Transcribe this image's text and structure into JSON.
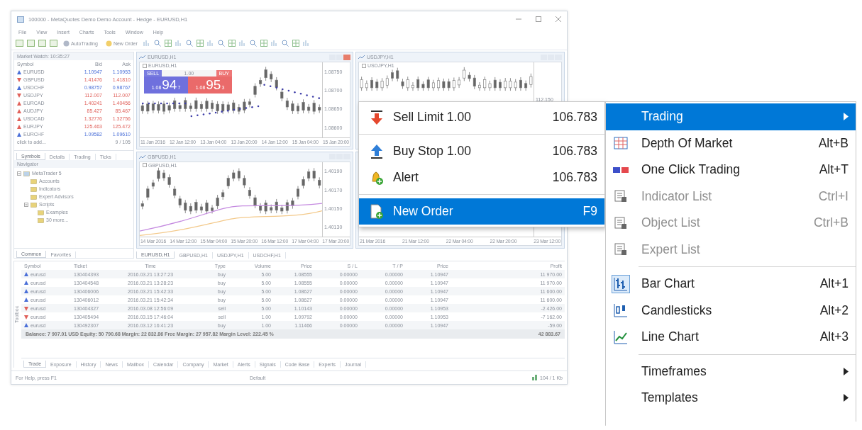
{
  "window": {
    "title": "100000 - MetaQuotes Demo Demo Account - Hedge - EURUSD,H1"
  },
  "menu": [
    "File",
    "View",
    "Insert",
    "Charts",
    "Tools",
    "Window",
    "Help"
  ],
  "toolbar": {
    "buttons": [
      "AutoTrading",
      "New Order"
    ]
  },
  "market_watch": {
    "title": "Market Watch: 10:35:27",
    "columns": [
      "Symbol",
      "Bid",
      "Ask"
    ],
    "rows": [
      {
        "symbol": "EURUSD",
        "bid": "1.10947",
        "ask": "1.10953",
        "kind": "up",
        "color": "#4a6fd8"
      },
      {
        "symbol": "GBPUSD",
        "bid": "1.41476",
        "ask": "1.41810",
        "kind": "down",
        "color": "#e0605a"
      },
      {
        "symbol": "USDCHF",
        "bid": "0.98757",
        "ask": "0.98767",
        "kind": "up",
        "color": "#4a6fd8"
      },
      {
        "symbol": "USDJPY",
        "bid": "112.007",
        "ask": "112.007",
        "kind": "down",
        "color": "#e0605a"
      },
      {
        "symbol": "EURCAD",
        "bid": "1.40241",
        "ask": "1.40456",
        "kind": "up",
        "color": "#e0605a"
      },
      {
        "symbol": "AUDJPY",
        "bid": "85.427",
        "ask": "85.467",
        "kind": "up",
        "color": "#e0605a"
      },
      {
        "symbol": "USDCAD",
        "bid": "1.32776",
        "ask": "1.32756",
        "kind": "up",
        "color": "#e0605a"
      },
      {
        "symbol": "EURJPY",
        "bid": "125.463",
        "ask": "125.472",
        "kind": "up",
        "color": "#e0605a"
      },
      {
        "symbol": "EURCHF",
        "bid": "1.09582",
        "ask": "1.09610",
        "kind": "up",
        "color": "#4a6fd8"
      }
    ],
    "add_row": "click to add...",
    "add_count": "9 / 105",
    "tabs": [
      {
        "label": "Symbols",
        "selected": true
      },
      {
        "label": "Details",
        "selected": false
      },
      {
        "label": "Trading",
        "selected": false
      },
      {
        "label": "Ticks",
        "selected": false
      }
    ]
  },
  "navigator": {
    "title": "Navigator",
    "tree": [
      {
        "label": "MetaTrader 5",
        "children": [
          {
            "label": "Accounts"
          },
          {
            "label": "Indicators"
          },
          {
            "label": "Expert Advisors"
          },
          {
            "label": "Scripts",
            "children": [
              {
                "label": "Examples"
              },
              {
                "label": "30 more..."
              }
            ]
          }
        ]
      }
    ],
    "tabs": [
      {
        "label": "Common",
        "selected": true
      },
      {
        "label": "Favorites",
        "selected": false
      }
    ]
  },
  "charts": [
    {
      "title": "EURUSD,H1",
      "symbol": "EURUSD,H1",
      "kind": "oneclick",
      "prices": [
        "1.08750",
        "1.08700",
        "1.08650",
        "1.08600"
      ],
      "times": [
        "11 Jan 2016",
        "12 Jan 12:00",
        "13 Jan 04:00",
        "13 Jan 20:00",
        "14 Jan 12:00",
        "15 Jan 04:00",
        "15 Jan 20:00"
      ],
      "trade_panel": {
        "sell_label": "SELL",
        "buy_label": "BUY",
        "lot": "1.00",
        "sell_price": {
          "small": "1.08",
          "big": "94",
          "sup": "7"
        },
        "buy_price": {
          "small": "1.08",
          "big": "95",
          "sup": "3"
        }
      }
    },
    {
      "title": "USDJPY,H1",
      "symbol": "USDJPY,H1",
      "kind": "candles",
      "prices": [
        "112.150"
      ]
    },
    {
      "title": "GBPUSD,H1",
      "symbol": "GBPUSD,H1",
      "kind": "lines",
      "prices": [
        "1.40190",
        "1.40170",
        "1.40150",
        "1.40130"
      ],
      "times": [
        "14 Mar 2016",
        "14 Mar 12:00",
        "15 Mar 04:00",
        "15 Mar 20:00",
        "16 Mar 12:00",
        "17 Mar 04:00",
        "17 Mar 20:00"
      ]
    },
    {
      "kind": "candles",
      "times": [
        "21 Mar 2016",
        "21 Mar 12:00",
        "22 Mar 04:00",
        "22 Mar 20:00",
        "23 Mar 12:00"
      ]
    }
  ],
  "chart_tabs": [
    {
      "label": "EURUSD,H1",
      "selected": true
    },
    {
      "label": "GBPUSD,H1",
      "selected": false
    },
    {
      "label": "USDJPY,H1",
      "selected": false
    },
    {
      "label": "USDCHF,H1",
      "selected": false
    }
  ],
  "toolbox": {
    "label": "Toolbox",
    "columns": [
      "Symbol",
      "Ticket",
      "Time",
      "Type",
      "Volume",
      "Price",
      "S / L",
      "T / P",
      "Price",
      "Profit"
    ],
    "rows": [
      {
        "kind": "buy",
        "symbol": "eurusd",
        "ticket": "130404393",
        "time": "2016.03.21 13:27:23",
        "type": "buy",
        "volume": "5.00",
        "price": "1.08555",
        "sl": "0.00000",
        "tp": "0.00000",
        "current": "1.10947",
        "profit": "11 970.00"
      },
      {
        "kind": "buy",
        "symbol": "eurusd",
        "ticket": "130404548",
        "time": "2016.03.21 13:28:23",
        "type": "buy",
        "volume": "5.00",
        "price": "1.08555",
        "sl": "0.00000",
        "tp": "0.00000",
        "current": "1.10947",
        "profit": "11 970.00"
      },
      {
        "kind": "buy",
        "symbol": "eurusd",
        "ticket": "130406006",
        "time": "2016.03.21 15:42:33",
        "type": "buy",
        "volume": "5.00",
        "price": "1.08627",
        "sl": "0.00000",
        "tp": "0.00000",
        "current": "1.10947",
        "profit": "11 600.00"
      },
      {
        "kind": "buy",
        "symbol": "eurusd",
        "ticket": "130406012",
        "time": "2016.03.21 15:42:34",
        "type": "buy",
        "volume": "5.00",
        "price": "1.08627",
        "sl": "0.00000",
        "tp": "0.00000",
        "current": "1.10947",
        "profit": "11 600.00"
      },
      {
        "kind": "sell",
        "symbol": "eurusd",
        "ticket": "130404327",
        "time": "2016.03.08 12:56:09",
        "type": "sell",
        "volume": "5.00",
        "price": "1.10143",
        "sl": "0.00000",
        "tp": "0.00000",
        "current": "1.10953",
        "profit": "-2 426.00"
      },
      {
        "kind": "sell",
        "symbol": "eurusd",
        "ticket": "130405494",
        "time": "2016.03.15 17:46:04",
        "type": "sell",
        "volume": "1.00",
        "price": "1.09792",
        "sl": "0.00000",
        "tp": "0.00000",
        "current": "1.10953",
        "profit": "-7 162.00"
      },
      {
        "kind": "buy",
        "symbol": "eurusd",
        "ticket": "130492307",
        "time": "2016.03.12 16:41:23",
        "type": "buy",
        "volume": "1.00",
        "price": "1.11466",
        "sl": "0.00000",
        "tp": "0.00000",
        "current": "1.10947",
        "profit": "-59.00"
      }
    ],
    "balance": "Balance: 7 907.01 USD  Equity: 50 790.68  Margin: 22 832.86  Free Margin: 27 957.82  Margin Level: 222.45 %",
    "total": "42 883.67",
    "tabs": [
      {
        "label": "Trade",
        "selected": true
      },
      {
        "label": "Exposure",
        "selected": false
      },
      {
        "label": "History",
        "selected": false
      },
      {
        "label": "News",
        "selected": false
      },
      {
        "label": "Mailbox",
        "selected": false
      },
      {
        "label": "Calendar",
        "selected": false
      },
      {
        "label": "Company",
        "selected": false
      },
      {
        "label": "Market",
        "selected": false
      },
      {
        "label": "Alerts",
        "selected": false
      },
      {
        "label": "Signals",
        "selected": false
      },
      {
        "label": "Code Base",
        "selected": false
      },
      {
        "label": "Experts",
        "selected": false
      },
      {
        "label": "Journal",
        "selected": false
      }
    ]
  },
  "status_bar": {
    "help": "For Help, press F1",
    "profile": "Default",
    "traffic": "104 / 1 Kb"
  },
  "order_menu": {
    "items": [
      {
        "kind": "command",
        "label": "Sell Limit 1.00",
        "value": "106.783",
        "selected": false
      },
      {
        "kind": "separator"
      },
      {
        "kind": "command",
        "label": "Buy Stop 1.00",
        "value": "106.783",
        "selected": false
      },
      {
        "kind": "command",
        "label": "Alert",
        "value": "106.783",
        "selected": false
      },
      {
        "kind": "separator"
      },
      {
        "kind": "command",
        "label": "New Order",
        "value": "F9",
        "selected": true
      }
    ]
  },
  "context_menu": {
    "items": [
      {
        "kind": "submenu",
        "label": "Trading",
        "selected": true,
        "disabled": false,
        "checked": false
      },
      {
        "kind": "command",
        "label": "Depth Of Market",
        "shortcut": "Alt+B",
        "selected": false,
        "disabled": false,
        "checked": false
      },
      {
        "kind": "command",
        "label": "One Click Trading",
        "shortcut": "Alt+T",
        "selected": false,
        "disabled": false,
        "checked": false
      },
      {
        "kind": "command",
        "label": "Indicator List",
        "shortcut": "Ctrl+I",
        "selected": false,
        "disabled": true,
        "checked": false
      },
      {
        "kind": "command",
        "label": "Object List",
        "shortcut": "Ctrl+B",
        "selected": false,
        "disabled": true,
        "checked": false
      },
      {
        "kind": "command",
        "label": "Expert List",
        "selected": false,
        "disabled": true,
        "checked": false
      },
      {
        "kind": "separator"
      },
      {
        "kind": "command",
        "label": "Bar Chart",
        "shortcut": "Alt+1",
        "selected": false,
        "disabled": false,
        "checked": true
      },
      {
        "kind": "command",
        "label": "Candlesticks",
        "shortcut": "Alt+2",
        "selected": false,
        "disabled": false,
        "checked": false
      },
      {
        "kind": "command",
        "label": "Line Chart",
        "shortcut": "Alt+3",
        "selected": false,
        "disabled": false,
        "checked": false
      },
      {
        "kind": "separator"
      },
      {
        "kind": "submenu",
        "label": "Timeframes",
        "selected": false,
        "disabled": false,
        "checked": false
      },
      {
        "kind": "submenu",
        "label": "Templates",
        "selected": false,
        "disabled": false,
        "checked": false
      }
    ]
  }
}
